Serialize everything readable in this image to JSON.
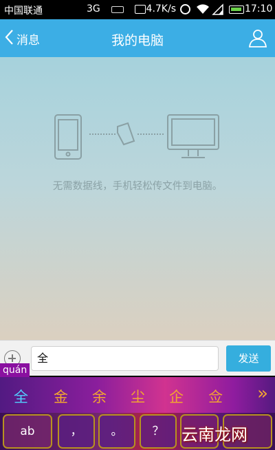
{
  "status_bar": {
    "carrier": "中国联通",
    "network": "3G",
    "speed": "4.7K/s",
    "time": "17:10"
  },
  "header": {
    "back_label": "消息",
    "title": "我的电脑"
  },
  "main": {
    "hint": "无需数据线，手机轻松传文件到电脑。"
  },
  "input_bar": {
    "value": "全",
    "send_label": "发送"
  },
  "ime": {
    "pinyin": "quán",
    "candidates": [
      "全",
      "金",
      "余",
      "尘",
      "企",
      "佥"
    ],
    "more": "»",
    "keys": {
      "ab": "ab",
      "comma": "，",
      "period": "。",
      "question": "？"
    }
  },
  "watermark": "云南龙网",
  "colors": {
    "header": "#3caee5",
    "send_button": "#35aede",
    "candidate_selected": "#53d0ff",
    "candidate": "#f2a531"
  }
}
